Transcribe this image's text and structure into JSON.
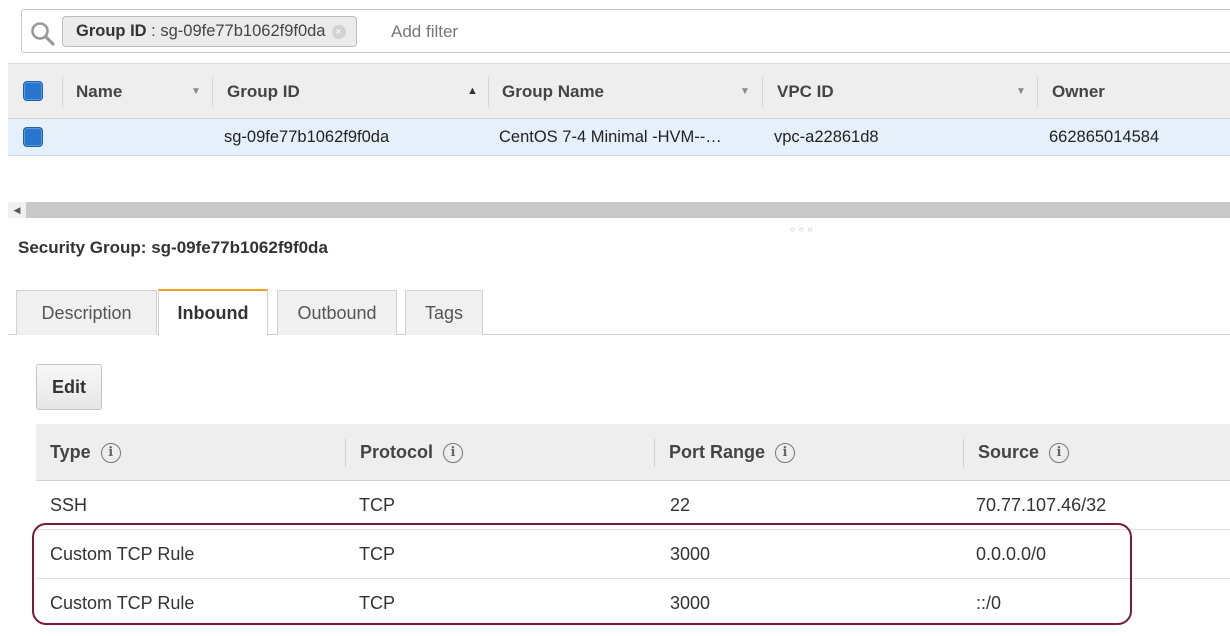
{
  "filter": {
    "chip_key": "Group ID",
    "chip_separator": " : ",
    "chip_value": "sg-09fe77b1062f9f0da",
    "chip_close_glyph": "×",
    "placeholder": "Add filter"
  },
  "top_table": {
    "columns": [
      "Name",
      "Group ID",
      "Group Name",
      "VPC ID",
      "Owner"
    ],
    "sorted_column": "Group ID",
    "sort_direction": "ascending",
    "rows": [
      {
        "selected": true,
        "name": "",
        "group_id": "sg-09fe77b1062f9f0da",
        "group_name": "CentOS 7-4 Minimal -HVM--…",
        "vpc_id": "vpc-a22861d8",
        "owner": "662865014584"
      }
    ]
  },
  "details": {
    "title_label": "Security Group: ",
    "title_value": "sg-09fe77b1062f9f0da",
    "tabs": [
      "Description",
      "Inbound",
      "Outbound",
      "Tags"
    ],
    "active_tab": "Inbound",
    "edit_label": "Edit"
  },
  "rules_table": {
    "columns": [
      "Type",
      "Protocol",
      "Port Range",
      "Source"
    ],
    "info_glyph": "i",
    "rows": [
      {
        "type": "SSH",
        "protocol": "TCP",
        "port_range": "22",
        "source": "70.77.107.46/32"
      },
      {
        "type": "Custom TCP Rule",
        "protocol": "TCP",
        "port_range": "3000",
        "source": "0.0.0.0/0"
      },
      {
        "type": "Custom TCP Rule",
        "protocol": "TCP",
        "port_range": "3000",
        "source": "::/0"
      }
    ],
    "highlighted_rows": [
      1,
      2
    ]
  },
  "colors": {
    "accent_tab": "#f0a022",
    "selected_row": "#e6f0fb",
    "checkbox": "#2775cf",
    "highlight_outline": "#7b1a36"
  }
}
